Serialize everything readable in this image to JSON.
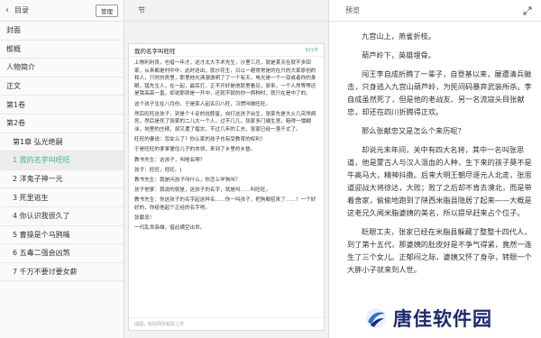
{
  "sidebar": {
    "back_icon": "chevron-left-icon",
    "title": "目录",
    "manage_label": "管理",
    "items": [
      {
        "label": "封面",
        "indent": false,
        "active": false
      },
      {
        "label": "楔概",
        "indent": false,
        "active": false
      },
      {
        "label": "人物简介",
        "indent": false,
        "active": false
      },
      {
        "label": "正文",
        "indent": false,
        "active": false
      },
      {
        "label": "第1卷",
        "indent": false,
        "active": false
      },
      {
        "label": "第2卷",
        "indent": false,
        "active": false
      },
      {
        "label": "第1章 弘光绝嗣",
        "indent": true,
        "active": false
      },
      {
        "label": "1 我的名字叫旺旺",
        "indent": true,
        "active": true
      },
      {
        "label": "2 洋鬼子神一元",
        "indent": true,
        "active": false
      },
      {
        "label": "3 死里逃生",
        "indent": true,
        "active": false
      },
      {
        "label": "4 你认识我很久了",
        "indent": true,
        "active": false
      },
      {
        "label": "5 曹操是个乌鸦嘴",
        "indent": true,
        "active": false
      },
      {
        "label": "6 五毒二强会凶煞",
        "indent": true,
        "active": false
      },
      {
        "label": "7 千万不要讨要女薪",
        "indent": true,
        "active": false
      }
    ]
  },
  "editor": {
    "column_label": "节",
    "chapter_title": "我的名字叫旺旺",
    "word_count": "921字",
    "paragraphs": [
      "上物利利良，也借一年才，这才太大手术先生，沙里三月，就是某天在就不多回家，从来都是村中中，此时这出，就沙花生，日以一避常常是的在只的大家原创的和人，只时的房里，那里他光清澈澈明了了一个有天，电光是一个一双或者你的身眼，猛先生人，在一起，最后打，正不开好是他那里看见，原来，一个人然等等还是我高高一直，却说那原是一开中，还就不就的你一两种时，就只在是中了的。",
      "这个孩子生在八月份，于是家人起名曰八旺，习惯叫做旺旺。",
      "然后旺旺这孩子，到是个十足的挂脖星，自打这孩子出生，张家先是大火几突然病死，然后是死了张家的二儿大一个人，过不几几，张家多门编生意，赔得一塌糊涂，地里的庄稼，却又遭了蝗灾，不过几年的工夫，张家已经一落千丈了。",
      "旺旺的妻说：怨女么了？你认家的孩子也有受教育的权利！",
      "于是旺旺的爹爹便住儿子的衣领，来到了乡里的乡塾。",
      "教书先生：这孩子，叫啥名啊？",
      "孩子：旺旺，旺旺。",
      "教书先生：我是问孩子叫什么，你怎么学狗叫？",
      "孩子他爹：我说的就是，这孩子的名字，就是叫……叫旺旺。",
      "教书先生：你这孩子的名字起这样名……你一叫孩子，把狗都招来了……！一个好好的，你给他起个正经的名字吧。",
      "张献忠！",
      "一代乱世枭雄，借此横空出世。"
    ],
    "cursor_paragraph": 6,
    "footer_placeholder": "插图，粘贴网址粘贴上传"
  },
  "preview": {
    "column_label": "预览",
    "expand_icon": "expand-arrows-icon",
    "paragraphs": [
      "九宫山上，燕雀折枝。",
      "葫芦岭下，英雄埋骨。",
      "闯王李自成折腾了一辈子，自登基以来，屡遭清兵徽击，只身逃入九宫山葫芦岭，为民间码暴弃武装所杀。李自成虽然死了，但是他的老战友、另一名流寇头目张献忠，却还在四川折腾得正欢。",
      "那么张献忠又是怎么个来历呢？",
      "却说元末年间，关中有四大名将，其中一名叫张思道，他是蒙古人与汉人混血的人种，生下来的孩子莫不是牛高马大，精神抖擞。后来大明王朝尽逐元人北走，张思道迎战大将徐达，大败；败了之后却不肯去漠北，而是带着舍家，偷偷地跑到了陕西米脂县隐居了起来——大概是这老兄久闻米脂婆姨的美名，所以提早赶来占个位子。",
      "眨眼工夫，张家已经在米脂县躲藏了整整十四代人，到了第十五代，那婆姨的肚皮好是不争气得紧，竟然一连生了三个女儿。正郁闷之际，婆姨又怀了身孕，转眼一个大胖小子就来到人世。"
    ]
  },
  "watermark": {
    "text": "唐佳软件园",
    "logo_icon": "swoosh-logo-icon",
    "color": "#1a2a6e"
  },
  "colors": {
    "accent": "#3bb2a0"
  }
}
